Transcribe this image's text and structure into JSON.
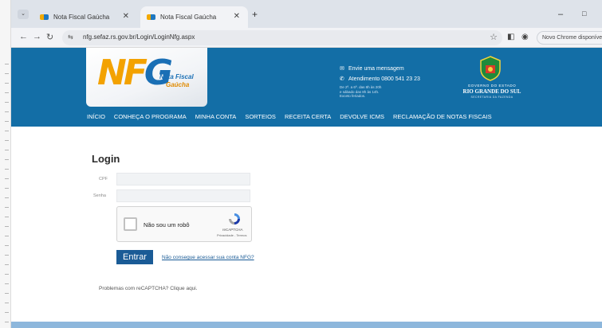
{
  "browser": {
    "tabs": [
      {
        "title": "Nota Fiscal Gaúcha",
        "active": false
      },
      {
        "title": "Nota Fiscal Gaúcha",
        "active": true
      }
    ],
    "new_tab": "+",
    "minimize": "–",
    "maximize": "□",
    "url": "nfg.sefaz.rs.gov.br/Login/LoginNfg.aspx",
    "new_chrome": "Novo Chrome disponível",
    "accent": "#dee3ea"
  },
  "site": {
    "brand_colors": {
      "primary": "#136ea6",
      "logo_orange": "#f3a200",
      "logo_blue": "#1a6fb5"
    },
    "logo": {
      "mark_nf": "NF",
      "mark_g": "G",
      "line1": "Nota Fiscal",
      "line2": "Gaúcha"
    },
    "contact": {
      "message": "Envie uma mensagem",
      "phone": "Atendimento 0800 541 23 23",
      "hours_line1": "De 2ª. a 6ª. das 8h às 20h",
      "hours_line2": "e sábado das 8h às 14h.",
      "hours_line3": "Exceto feriados."
    },
    "government": {
      "line1": "GOVERNO DO ESTADO",
      "line2": "RIO GRANDE DO SUL",
      "line3": "SECRETARIA DA FAZENDA"
    },
    "menu": [
      "Início",
      "Conheça o Programa",
      "Minha Conta",
      "Sorteios",
      "Receita Certa",
      "Devolve ICMS",
      "Reclamação de Notas Fiscais"
    ]
  },
  "login": {
    "title": "Login",
    "cpf_label": "CPF",
    "cpf_value": "",
    "senha_label": "Senha",
    "senha_value": "",
    "captcha_text": "Não sou um robô",
    "captcha_brand": "reCAPTCHA",
    "captcha_terms": "Privacidade - Termos",
    "submit": "Entrar",
    "forgot": "Não consegue acessar sua conta NFG?",
    "problem": "Problemas com reCAPTCHA? Clique aqui."
  }
}
